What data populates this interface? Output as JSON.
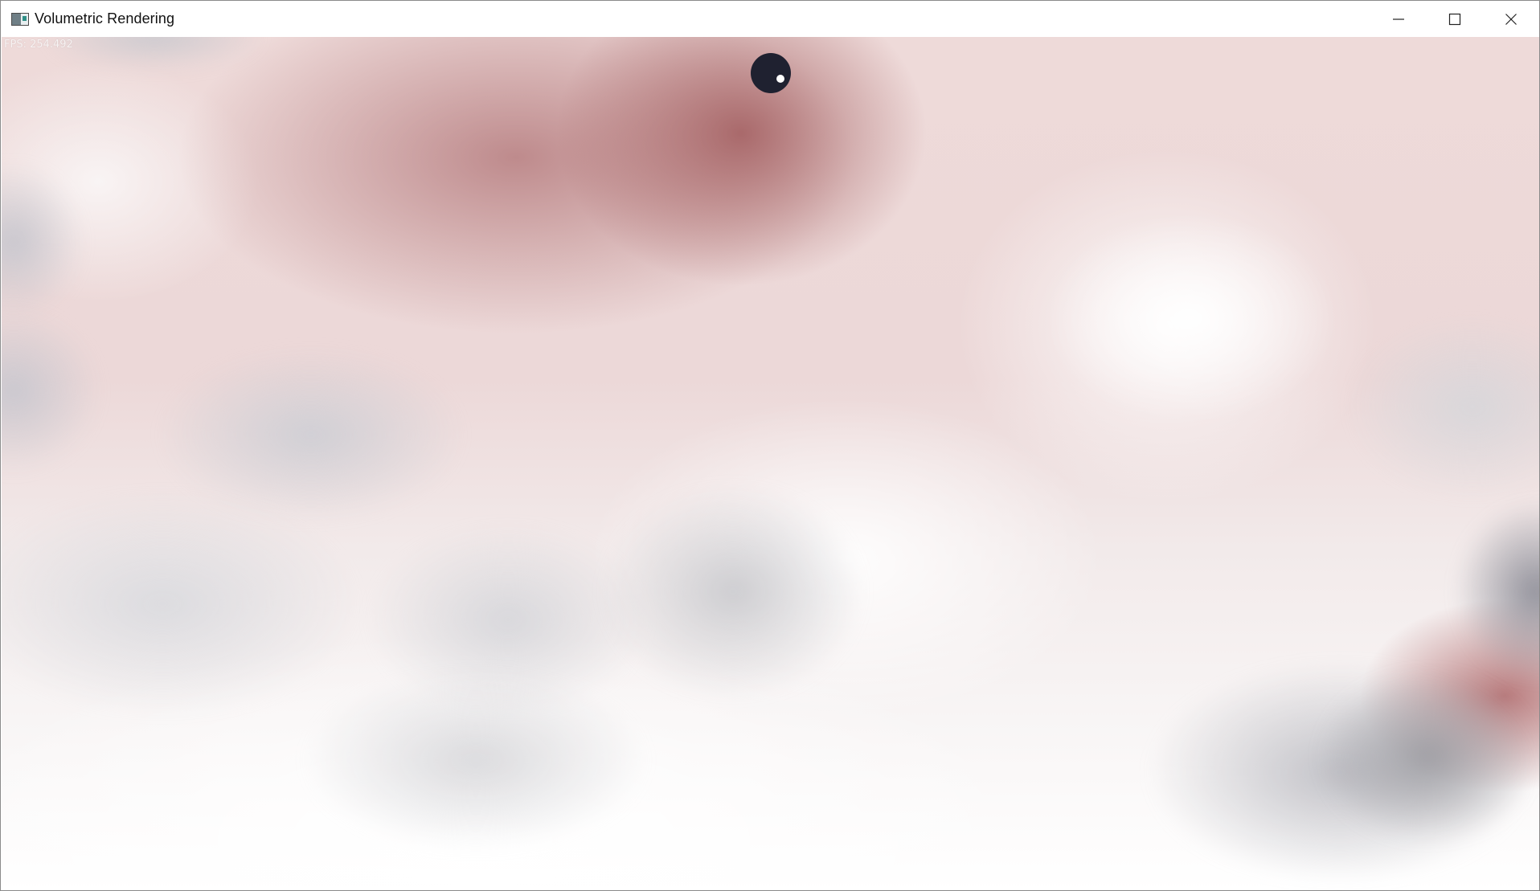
{
  "window": {
    "title": "Volumetric Rendering",
    "icon": "app-window-icon"
  },
  "controls": {
    "minimize_icon": "minimize-icon",
    "maximize_icon": "maximize-icon",
    "close_icon": "close-icon"
  },
  "overlay": {
    "fps_label": "FPS: 254.492"
  },
  "colors": {
    "cloud_red": "#a55f61",
    "cloud_pink": "#ecd8d8",
    "cloud_gray": "#d3d4d9",
    "cursor": "#1f2130"
  }
}
